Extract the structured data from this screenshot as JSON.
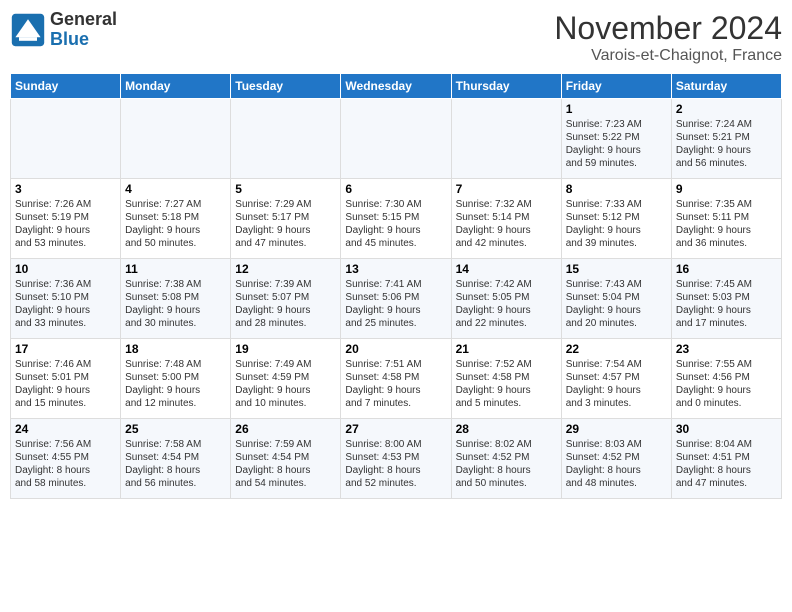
{
  "header": {
    "logo_general": "General",
    "logo_blue": "Blue",
    "month_title": "November 2024",
    "location": "Varois-et-Chaignot, France"
  },
  "weekdays": [
    "Sunday",
    "Monday",
    "Tuesday",
    "Wednesday",
    "Thursday",
    "Friday",
    "Saturday"
  ],
  "weeks": [
    [
      {
        "day": "",
        "info": ""
      },
      {
        "day": "",
        "info": ""
      },
      {
        "day": "",
        "info": ""
      },
      {
        "day": "",
        "info": ""
      },
      {
        "day": "",
        "info": ""
      },
      {
        "day": "1",
        "info": "Sunrise: 7:23 AM\nSunset: 5:22 PM\nDaylight: 9 hours\nand 59 minutes."
      },
      {
        "day": "2",
        "info": "Sunrise: 7:24 AM\nSunset: 5:21 PM\nDaylight: 9 hours\nand 56 minutes."
      }
    ],
    [
      {
        "day": "3",
        "info": "Sunrise: 7:26 AM\nSunset: 5:19 PM\nDaylight: 9 hours\nand 53 minutes."
      },
      {
        "day": "4",
        "info": "Sunrise: 7:27 AM\nSunset: 5:18 PM\nDaylight: 9 hours\nand 50 minutes."
      },
      {
        "day": "5",
        "info": "Sunrise: 7:29 AM\nSunset: 5:17 PM\nDaylight: 9 hours\nand 47 minutes."
      },
      {
        "day": "6",
        "info": "Sunrise: 7:30 AM\nSunset: 5:15 PM\nDaylight: 9 hours\nand 45 minutes."
      },
      {
        "day": "7",
        "info": "Sunrise: 7:32 AM\nSunset: 5:14 PM\nDaylight: 9 hours\nand 42 minutes."
      },
      {
        "day": "8",
        "info": "Sunrise: 7:33 AM\nSunset: 5:12 PM\nDaylight: 9 hours\nand 39 minutes."
      },
      {
        "day": "9",
        "info": "Sunrise: 7:35 AM\nSunset: 5:11 PM\nDaylight: 9 hours\nand 36 minutes."
      }
    ],
    [
      {
        "day": "10",
        "info": "Sunrise: 7:36 AM\nSunset: 5:10 PM\nDaylight: 9 hours\nand 33 minutes."
      },
      {
        "day": "11",
        "info": "Sunrise: 7:38 AM\nSunset: 5:08 PM\nDaylight: 9 hours\nand 30 minutes."
      },
      {
        "day": "12",
        "info": "Sunrise: 7:39 AM\nSunset: 5:07 PM\nDaylight: 9 hours\nand 28 minutes."
      },
      {
        "day": "13",
        "info": "Sunrise: 7:41 AM\nSunset: 5:06 PM\nDaylight: 9 hours\nand 25 minutes."
      },
      {
        "day": "14",
        "info": "Sunrise: 7:42 AM\nSunset: 5:05 PM\nDaylight: 9 hours\nand 22 minutes."
      },
      {
        "day": "15",
        "info": "Sunrise: 7:43 AM\nSunset: 5:04 PM\nDaylight: 9 hours\nand 20 minutes."
      },
      {
        "day": "16",
        "info": "Sunrise: 7:45 AM\nSunset: 5:03 PM\nDaylight: 9 hours\nand 17 minutes."
      }
    ],
    [
      {
        "day": "17",
        "info": "Sunrise: 7:46 AM\nSunset: 5:01 PM\nDaylight: 9 hours\nand 15 minutes."
      },
      {
        "day": "18",
        "info": "Sunrise: 7:48 AM\nSunset: 5:00 PM\nDaylight: 9 hours\nand 12 minutes."
      },
      {
        "day": "19",
        "info": "Sunrise: 7:49 AM\nSunset: 4:59 PM\nDaylight: 9 hours\nand 10 minutes."
      },
      {
        "day": "20",
        "info": "Sunrise: 7:51 AM\nSunset: 4:58 PM\nDaylight: 9 hours\nand 7 minutes."
      },
      {
        "day": "21",
        "info": "Sunrise: 7:52 AM\nSunset: 4:58 PM\nDaylight: 9 hours\nand 5 minutes."
      },
      {
        "day": "22",
        "info": "Sunrise: 7:54 AM\nSunset: 4:57 PM\nDaylight: 9 hours\nand 3 minutes."
      },
      {
        "day": "23",
        "info": "Sunrise: 7:55 AM\nSunset: 4:56 PM\nDaylight: 9 hours\nand 0 minutes."
      }
    ],
    [
      {
        "day": "24",
        "info": "Sunrise: 7:56 AM\nSunset: 4:55 PM\nDaylight: 8 hours\nand 58 minutes."
      },
      {
        "day": "25",
        "info": "Sunrise: 7:58 AM\nSunset: 4:54 PM\nDaylight: 8 hours\nand 56 minutes."
      },
      {
        "day": "26",
        "info": "Sunrise: 7:59 AM\nSunset: 4:54 PM\nDaylight: 8 hours\nand 54 minutes."
      },
      {
        "day": "27",
        "info": "Sunrise: 8:00 AM\nSunset: 4:53 PM\nDaylight: 8 hours\nand 52 minutes."
      },
      {
        "day": "28",
        "info": "Sunrise: 8:02 AM\nSunset: 4:52 PM\nDaylight: 8 hours\nand 50 minutes."
      },
      {
        "day": "29",
        "info": "Sunrise: 8:03 AM\nSunset: 4:52 PM\nDaylight: 8 hours\nand 48 minutes."
      },
      {
        "day": "30",
        "info": "Sunrise: 8:04 AM\nSunset: 4:51 PM\nDaylight: 8 hours\nand 47 minutes."
      }
    ]
  ]
}
